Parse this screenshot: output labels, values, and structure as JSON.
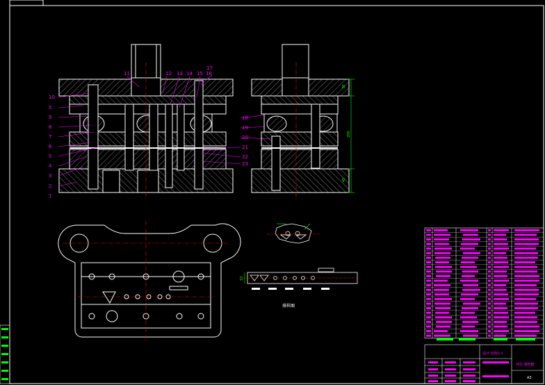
{
  "drawing": {
    "part_labels_front": [
      "10",
      "5",
      "9",
      "8",
      "7",
      "6",
      "5",
      "4",
      "3",
      "2",
      "1"
    ],
    "part_labels_top": [
      "11",
      "12",
      "13",
      "14",
      "15",
      "16",
      "17"
    ],
    "part_labels_mid": [
      "21",
      "22",
      "23"
    ],
    "part_labels_side": [
      "18",
      "19",
      "20"
    ],
    "dimension_side_top": "38",
    "dimension_side_total": "200",
    "dimension_side_bottom": "45",
    "strip_caption": "排样图",
    "strip_dim": "10",
    "title_block": {
      "scale_text": "设计 比例1:1",
      "name_text": "冲孔 落料模",
      "drawing_no": "A3"
    },
    "colors": {
      "outline": "#ffffff",
      "centerline": "#ff0000",
      "labels": "#ff00ff",
      "hatch": "#7a7a7a",
      "table_fill": "#ff00ff",
      "table_green": "#00ff00"
    }
  }
}
